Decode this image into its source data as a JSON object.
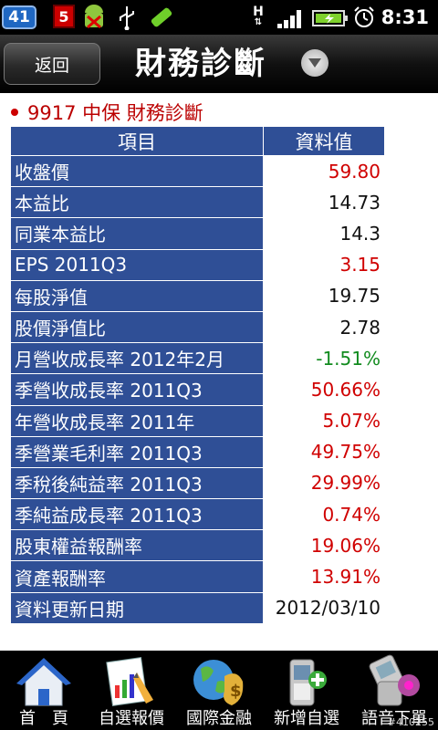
{
  "status_bar": {
    "notification_count": "41",
    "badge_number": "5",
    "network_type": "H",
    "time": "8:31"
  },
  "header": {
    "back_label": "返回",
    "title": "財務診斷"
  },
  "subtitle": "9917 中保 財務診斷",
  "table": {
    "col_item": "項目",
    "col_value": "資料值",
    "rows": [
      {
        "label": "收盤價",
        "value": "59.80",
        "color": "#d00000"
      },
      {
        "label": "本益比",
        "value": "14.73",
        "color": "#111111"
      },
      {
        "label": "同業本益比",
        "value": "14.3",
        "color": "#111111"
      },
      {
        "label": "EPS 2011Q3",
        "value": "3.15",
        "color": "#d00000"
      },
      {
        "label": "每股淨值",
        "value": "19.75",
        "color": "#111111"
      },
      {
        "label": "股價淨值比",
        "value": "2.78",
        "color": "#111111"
      },
      {
        "label": "月營收成長率 2012年2月",
        "value": "-1.51%",
        "color": "#118b1e"
      },
      {
        "label": "季營收成長率 2011Q3",
        "value": "50.66%",
        "color": "#d00000"
      },
      {
        "label": "年營收成長率 2011年",
        "value": "5.07%",
        "color": "#d00000"
      },
      {
        "label": "季營業毛利率 2011Q3",
        "value": "49.75%",
        "color": "#d00000"
      },
      {
        "label": "季稅後純益率 2011Q3",
        "value": "29.99%",
        "color": "#d00000"
      },
      {
        "label": "季純益成長率 2011Q3",
        "value": "0.74%",
        "color": "#d00000"
      },
      {
        "label": "股東權益報酬率",
        "value": "19.06%",
        "color": "#d00000"
      },
      {
        "label": "資產報酬率",
        "value": "13.91%",
        "color": "#d00000"
      },
      {
        "label": "資料更新日期",
        "value": "2012/03/10",
        "color": "#111111"
      }
    ]
  },
  "bottom_nav": [
    {
      "label": "首　頁",
      "icon": "home-icon"
    },
    {
      "label": "自選報價",
      "icon": "quote-chart-icon"
    },
    {
      "label": "國際金融",
      "icon": "globe-money-icon"
    },
    {
      "label": "新增自選",
      "icon": "add-phone-icon"
    },
    {
      "label": "語音下單",
      "icon": "voice-phone-icon"
    }
  ],
  "watermark": "#410255",
  "colors": {
    "table_header_bg": "#2f4f96",
    "up_red": "#d00000",
    "down_green": "#118b1e"
  }
}
